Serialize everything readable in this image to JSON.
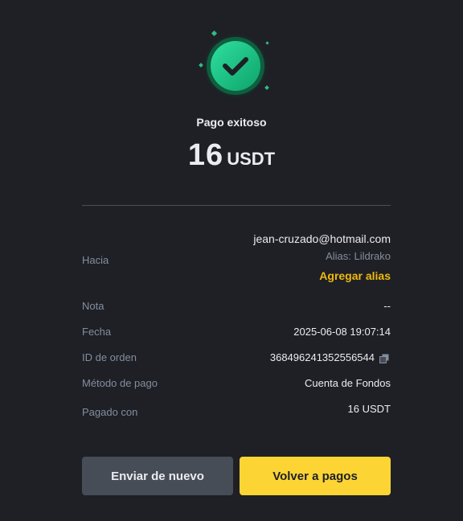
{
  "status": {
    "icon": "check-circle-icon",
    "title": "Pago exitoso",
    "amount": "16",
    "currency": "USDT",
    "accent": "#2ebd85"
  },
  "details": {
    "to": {
      "label": "Hacia",
      "email": "jean-cruzado@hotmail.com",
      "alias": "Alias: Lildrako",
      "add_alias": "Agregar alias"
    },
    "note": {
      "label": "Nota",
      "value": "--"
    },
    "date": {
      "label": "Fecha",
      "value": "2025-06-08 19:07:14"
    },
    "order_id": {
      "label": "ID de orden",
      "value": "368496241352556544",
      "icon": "copy-icon"
    },
    "method": {
      "label": "Método de pago",
      "value": "Cuenta de Fondos"
    },
    "paid_with": {
      "label": "Pagado con",
      "value": "16 USDT"
    }
  },
  "actions": {
    "send_again": "Enviar de nuevo",
    "back_to_payments": "Volver a pagos",
    "primary_color": "#fcd535"
  }
}
